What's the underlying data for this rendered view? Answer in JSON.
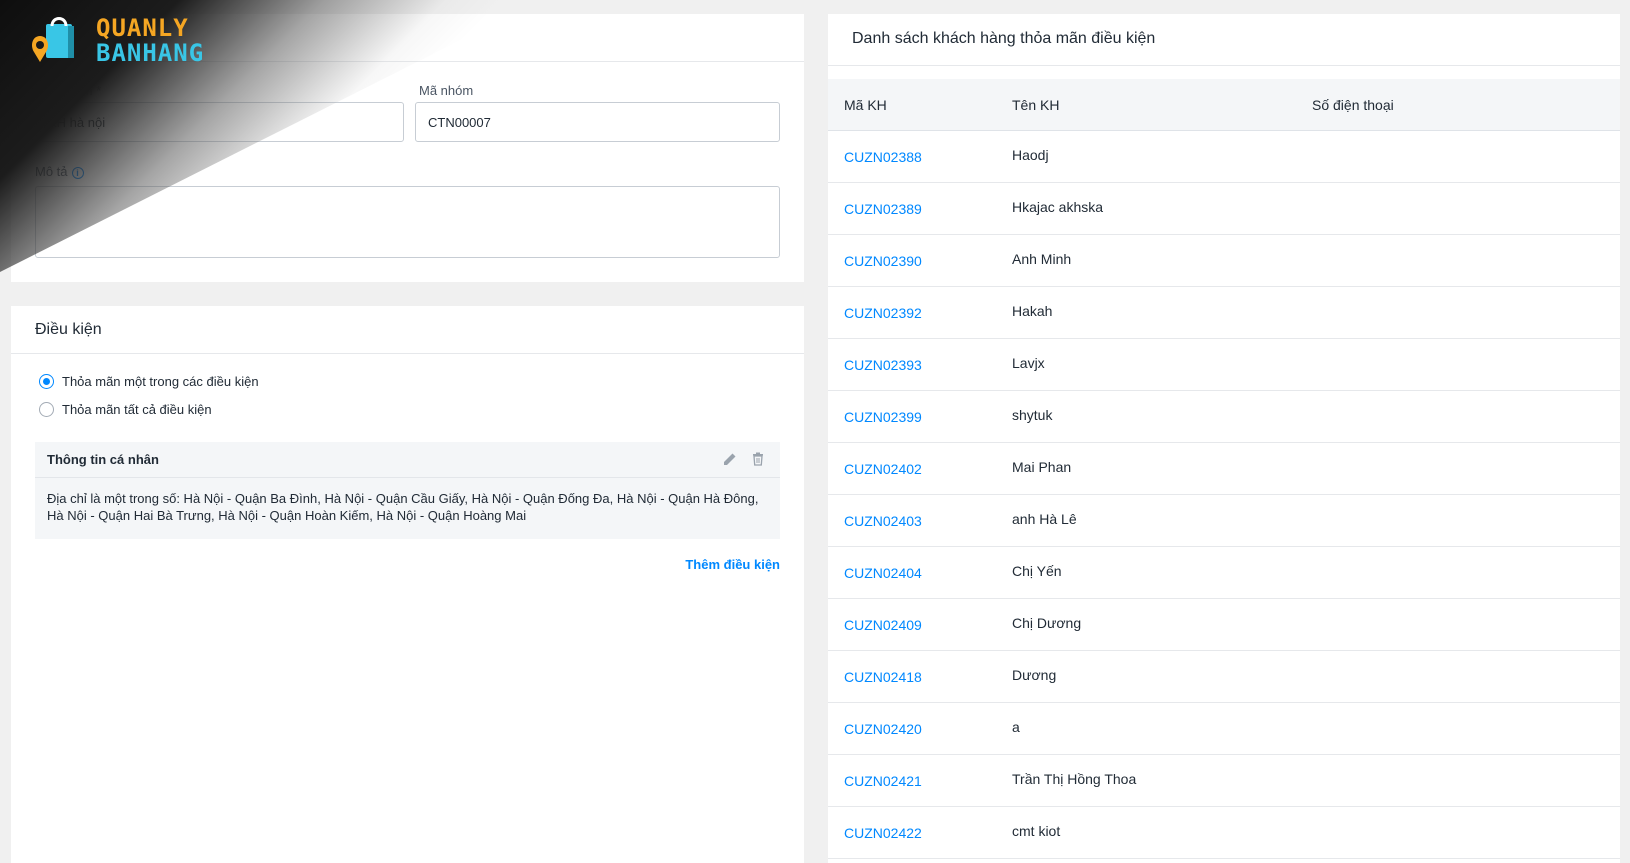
{
  "logo": {
    "line1": "QUANLY",
    "line2": "BANHANG"
  },
  "group_form": {
    "name_label": "nhóm *",
    "name_value": "KH hà nội",
    "code_label": "Mã nhóm",
    "code_value": "CTN00007",
    "description_label": "Mô tả",
    "description_value": ""
  },
  "conditions": {
    "title": "Điều kiện",
    "option_any": "Thỏa mãn một trong các điều kiện",
    "option_all": "Thỏa mãn tất cả điều kiện",
    "selected": "any",
    "block": {
      "title": "Thông tin cá nhân",
      "description": "Địa chỉ là một trong số: Hà Nội - Quận Ba Đình, Hà Nội - Quận Cầu Giấy, Hà Nội - Quận Đống Đa, Hà Nội - Quận Hà Đông, Hà Nội - Quận Hai Bà Trưng, Hà Nội - Quận Hoàn Kiếm, Hà Nội - Quận Hoàng Mai"
    },
    "add_label": "Thêm điều kiện"
  },
  "customer_list": {
    "title": "Danh sách khách hàng thỏa mãn điều kiện",
    "columns": [
      "Mã KH",
      "Tên KH",
      "Số điện thoại"
    ],
    "rows": [
      {
        "code": "CUZN02388",
        "name": "Haodj",
        "phone": ""
      },
      {
        "code": "CUZN02389",
        "name": "Hkajac akhska",
        "phone": ""
      },
      {
        "code": "CUZN02390",
        "name": "Anh Minh",
        "phone": ""
      },
      {
        "code": "CUZN02392",
        "name": "Hakah",
        "phone": ""
      },
      {
        "code": "CUZN02393",
        "name": "Lavjx",
        "phone": ""
      },
      {
        "code": "CUZN02399",
        "name": "shytuk",
        "phone": ""
      },
      {
        "code": "CUZN02402",
        "name": "Mai Phan",
        "phone": ""
      },
      {
        "code": "CUZN02403",
        "name": "anh Hà Lê",
        "phone": ""
      },
      {
        "code": "CUZN02404",
        "name": "Chị Yến",
        "phone": ""
      },
      {
        "code": "CUZN02409",
        "name": "Chị Dương",
        "phone": ""
      },
      {
        "code": "CUZN02418",
        "name": "Dương",
        "phone": ""
      },
      {
        "code": "CUZN02420",
        "name": "a",
        "phone": ""
      },
      {
        "code": "CUZN02421",
        "name": "Trần Thị Hồng Thoa",
        "phone": ""
      },
      {
        "code": "CUZN02422",
        "name": "cmt kiot",
        "phone": ""
      }
    ]
  },
  "colors": {
    "accent": "#0088ff",
    "logo_orange": "#f5a623",
    "logo_cyan": "#39c6e6"
  }
}
